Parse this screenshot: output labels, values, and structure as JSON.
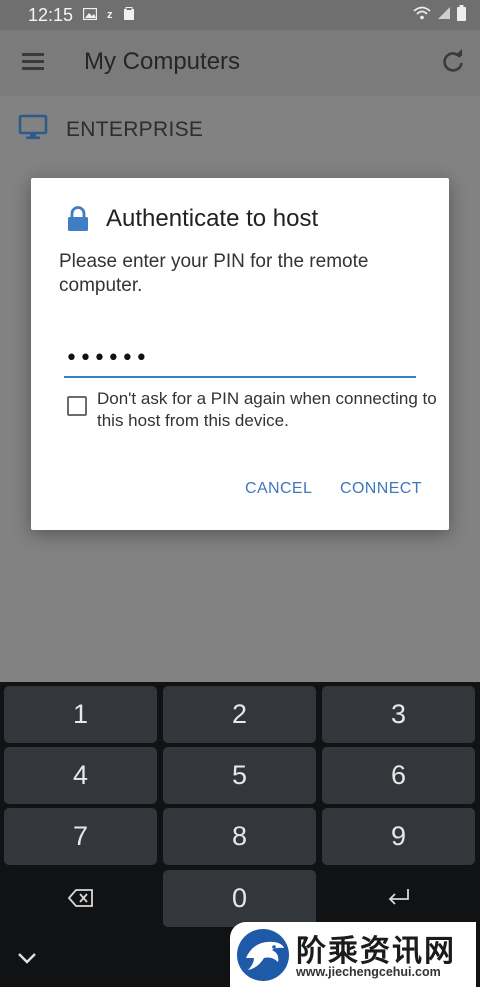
{
  "status_bar": {
    "time": "12:15",
    "icons_left": [
      "image-icon",
      "z-notification-icon",
      "clipboard-icon"
    ],
    "icons_right": [
      "wifi-icon",
      "signal-icon",
      "battery-icon"
    ]
  },
  "app_bar": {
    "title": "My Computers",
    "menu_icon": "hamburger-menu-icon",
    "refresh_icon": "refresh-icon"
  },
  "host_list": [
    {
      "name": "ENTERPRISE",
      "icon": "monitor-icon"
    }
  ],
  "dialog": {
    "title": "Authenticate to host",
    "message": "Please enter your PIN for the remote computer.",
    "pin_value": "••••••",
    "checkbox_label": "Don't ask for a PIN again when connecting to this host from this device.",
    "checkbox_checked": false,
    "cancel_label": "CANCEL",
    "connect_label": "CONNECT"
  },
  "keyboard": {
    "keys": [
      {
        "label": "1"
      },
      {
        "label": "2"
      },
      {
        "label": "3"
      },
      {
        "label": "4"
      },
      {
        "label": "5"
      },
      {
        "label": "6"
      },
      {
        "label": "7"
      },
      {
        "label": "8"
      },
      {
        "label": "9"
      },
      {
        "label": "",
        "icon": "backspace-icon"
      },
      {
        "label": "0"
      },
      {
        "label": "",
        "icon": "enter-icon"
      }
    ]
  },
  "watermark": {
    "text": "阶乘资讯网",
    "url": "www.jiechengcehui.com"
  },
  "colors": {
    "accent": "#3e78bd",
    "keyboard_bg": "#101214",
    "key_bg": "#33373b"
  }
}
